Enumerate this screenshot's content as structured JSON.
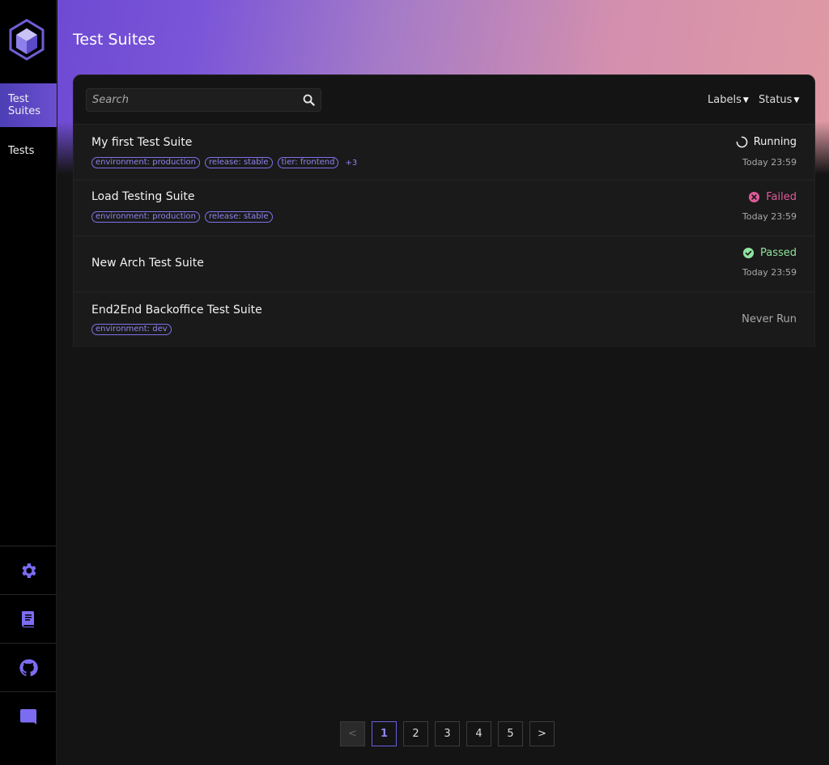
{
  "sidebar": {
    "nav": [
      {
        "label": "Test Suites"
      },
      {
        "label": "Tests"
      }
    ],
    "bottom_icons": [
      "gear-icon",
      "book-icon",
      "github-icon",
      "discord-icon"
    ],
    "accent": "#7b6cf2"
  },
  "header": {
    "title": "Test Suites"
  },
  "toolbar": {
    "search_placeholder": "Search",
    "filters": [
      {
        "label": "Labels"
      },
      {
        "label": "Status"
      }
    ]
  },
  "suites": [
    {
      "name": "My first Test Suite",
      "labels": [
        "environment: production",
        "release: stable",
        "tier: frontend"
      ],
      "more": "+3",
      "status": "Running",
      "status_color": "#f2f2f2",
      "time": "Today 23:59"
    },
    {
      "name": "Load Testing Suite",
      "labels": [
        "environment: production",
        "release: stable"
      ],
      "status": "Failed",
      "status_color": "#e05a9a",
      "time": "Today 23:59"
    },
    {
      "name": "New Arch Test Suite",
      "labels": [],
      "status": "Passed",
      "status_color": "#8fe39f",
      "time": "Today 23:59"
    },
    {
      "name": "End2End Backoffice Test Suite",
      "labels": [
        "environment: dev"
      ],
      "status": "Never Run",
      "status_color": "#a8a8a8"
    }
  ],
  "pagination": {
    "pages": [
      "1",
      "2",
      "3",
      "4",
      "5"
    ],
    "current": "1",
    "prev": "<",
    "next": ">"
  }
}
